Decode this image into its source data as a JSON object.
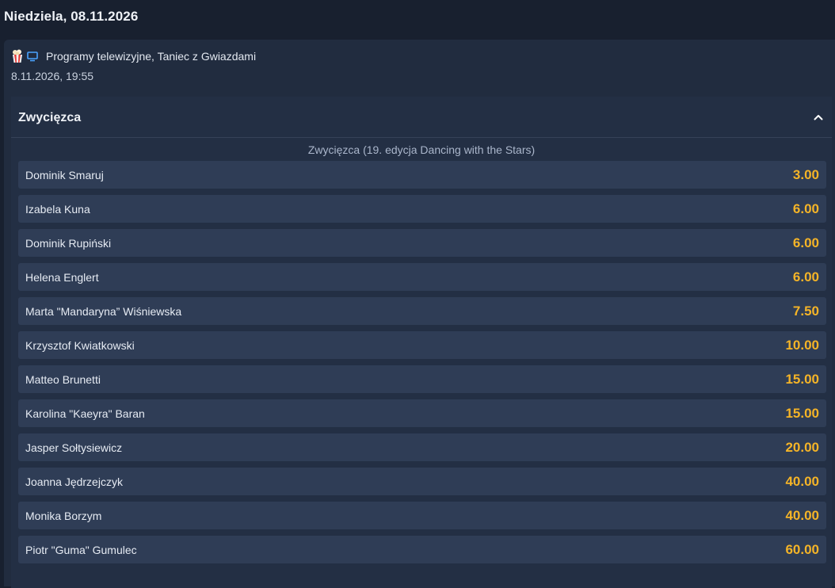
{
  "header": {
    "date": "Niedziela, 08.11.2026"
  },
  "event": {
    "icons": [
      "popcorn-icon",
      "tv-icon"
    ],
    "title": "Programy telewizyjne, Taniec z Gwiazdami",
    "datetime": "8.11.2026, 19:55"
  },
  "market": {
    "title": "Zwycięzca",
    "subtitle": "Zwycięzca (19. edycja Dancing with the Stars)",
    "collapse_icon": "chevron-up-icon",
    "outcomes": [
      {
        "name": "Dominik Smaruj",
        "odds": "3.00"
      },
      {
        "name": "Izabela Kuna",
        "odds": "6.00"
      },
      {
        "name": "Dominik Rupiński",
        "odds": "6.00"
      },
      {
        "name": "Helena Englert",
        "odds": "6.00"
      },
      {
        "name": "Marta \"Mandaryna” Wiśniewska",
        "odds": "7.50"
      },
      {
        "name": "Krzysztof Kwiatkowski",
        "odds": "10.00"
      },
      {
        "name": "Matteo Brunetti",
        "odds": "15.00"
      },
      {
        "name": "Karolina \"Kaeyra\" Baran",
        "odds": "15.00"
      },
      {
        "name": "Jasper Sołtysiewicz",
        "odds": "20.00"
      },
      {
        "name": "Joanna Jędrzejczyk",
        "odds": "40.00"
      },
      {
        "name": "Monika Borzym",
        "odds": "40.00"
      },
      {
        "name": "Piotr \"Guma\" Gumulec",
        "odds": "60.00"
      }
    ]
  },
  "colors": {
    "background": "#18202f",
    "card": "#212c3f",
    "row": "#2f3d56",
    "odds": "#f5b427"
  }
}
